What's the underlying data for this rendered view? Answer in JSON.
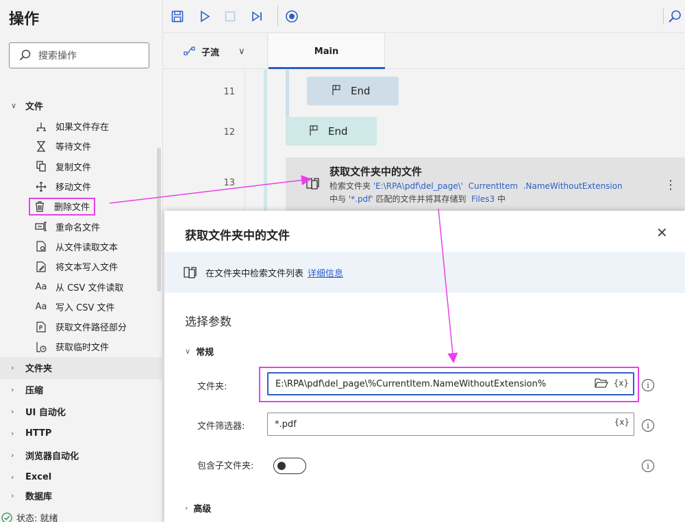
{
  "left_panel": {
    "title": "操作",
    "search_placeholder": "搜索操作",
    "categories_top": [
      {
        "label": "文件",
        "expanded": true
      }
    ],
    "file_items": [
      {
        "label": "如果文件存在",
        "icon": "branch-icon"
      },
      {
        "label": "等待文件",
        "icon": "hourglass-icon"
      },
      {
        "label": "复制文件",
        "icon": "copy-icon"
      },
      {
        "label": "移动文件",
        "icon": "move-icon"
      },
      {
        "label": "删除文件",
        "icon": "trash-icon",
        "highlighted": true
      },
      {
        "label": "重命名文件",
        "icon": "rename-icon"
      },
      {
        "label": "从文件读取文本",
        "icon": "read-file-icon"
      },
      {
        "label": "将文本写入文件",
        "icon": "write-file-icon"
      },
      {
        "label": "从 CSV 文件读取",
        "icon": "font-icon"
      },
      {
        "label": "写入 CSV 文件",
        "icon": "font-icon"
      },
      {
        "label": "获取文件路径部分",
        "icon": "file-path-icon"
      },
      {
        "label": "获取临时文件",
        "icon": "temp-file-icon"
      }
    ],
    "categories": [
      {
        "label": "文件夹",
        "active": true
      },
      {
        "label": "压缩"
      },
      {
        "label": "UI 自动化"
      },
      {
        "label": "HTTP"
      },
      {
        "label": "浏览器自动化"
      },
      {
        "label": "Excel"
      },
      {
        "label": "数据库"
      }
    ],
    "status": "状态: 就绪"
  },
  "toolbar": {
    "icons": [
      "save-icon",
      "run-icon",
      "stop-icon",
      "step-icon",
      "record-icon",
      "search-icon"
    ]
  },
  "tabs": {
    "subflow_label": "子流",
    "main_label": "Main"
  },
  "editor": {
    "line_numbers": [
      "11",
      "12",
      "13"
    ],
    "end_inner": "End",
    "end_outer": "End",
    "action": {
      "title": "获取文件夹中的文件",
      "line1_prefix": "检索文件夹 ",
      "line1_path": "'E:\\RPA\\pdf\\del_page\\'",
      "line1_var": "CurrentItem",
      "line1_prop": ".NameWithoutExtension",
      "line2_prefix": "中与 ",
      "line2_filter": "'*.pdf'",
      "line2_mid": " 匹配的文件并将其存储到 ",
      "line2_var": "Files3",
      "line2_suffix": " 中"
    }
  },
  "dialog": {
    "title": "获取文件夹中的文件",
    "info_text": "在文件夹中检索文件列表",
    "info_link": "详细信息",
    "section": "选择参数",
    "group_general": "常规",
    "folder_label": "文件夹:",
    "folder_value": "E:\\RPA\\pdf\\del_page\\%CurrentItem.NameWithoutExtension%",
    "filter_label": "文件筛选器:",
    "filter_value": "*.pdf",
    "subfolder_label": "包含子文件夹:",
    "subfolder_on": false,
    "group_advanced": "高级",
    "var_button": "{x}"
  },
  "colors": {
    "accent": "#2b5fc7",
    "annotation": "#e840e8",
    "end_block_teal": "#cfe8e8",
    "end_block_blue": "#cfdde8"
  }
}
